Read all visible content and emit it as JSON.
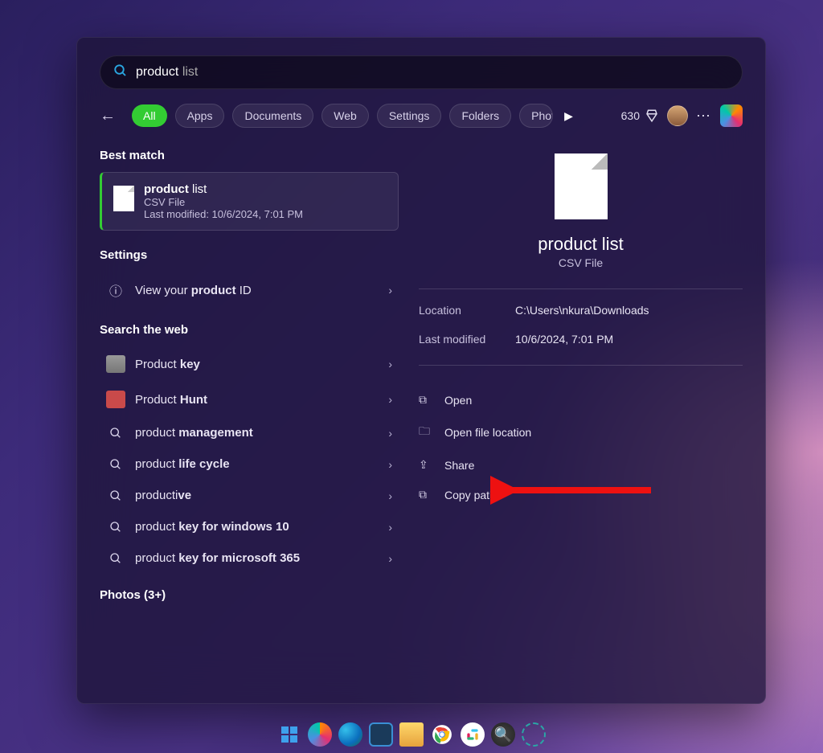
{
  "search": {
    "bold": "product",
    "tail": " list"
  },
  "filters": [
    "All",
    "Apps",
    "Documents",
    "Web",
    "Settings",
    "Folders",
    "Photos"
  ],
  "activeFilter": "All",
  "points": "630",
  "sections": {
    "best_h": "Best match",
    "settings_h": "Settings",
    "web_h": "Search the web",
    "photos_h": "Photos (3+)"
  },
  "best": {
    "title_b": "product",
    "title_t": " list",
    "type": "CSV File",
    "modified": "Last modified: 10/6/2024, 7:01 PM"
  },
  "settings": [
    {
      "pre": "View your ",
      "b": "product",
      "post": " ID"
    }
  ],
  "web": [
    {
      "kind": "thumb-alt",
      "pre": "Product ",
      "b": "key",
      "post": ""
    },
    {
      "kind": "thumb",
      "pre": "Product ",
      "b": "Hunt",
      "post": ""
    },
    {
      "kind": "search",
      "pre": "product ",
      "b": "management",
      "post": ""
    },
    {
      "kind": "search",
      "pre": "product ",
      "b": "life cycle",
      "post": ""
    },
    {
      "kind": "search",
      "pre": "producti",
      "b": "ve",
      "post": ""
    },
    {
      "kind": "search",
      "pre": "product ",
      "b": "key for windows 10",
      "post": ""
    },
    {
      "kind": "search",
      "pre": "product ",
      "b": "key for microsoft 365",
      "post": ""
    }
  ],
  "preview": {
    "title": "product list",
    "type": "CSV File",
    "location_k": "Location",
    "location_v": "C:\\Users\\nkura\\Downloads",
    "modified_k": "Last modified",
    "modified_v": "10/6/2024, 7:01 PM"
  },
  "actions": {
    "open": "Open",
    "openloc": "Open file location",
    "share": "Share",
    "copy": "Copy path"
  }
}
